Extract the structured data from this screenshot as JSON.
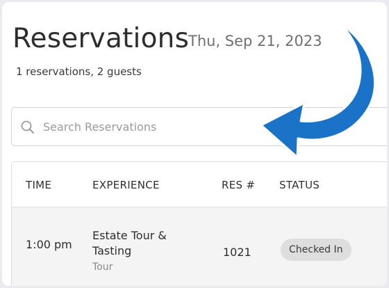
{
  "header": {
    "title": "Reservations",
    "date": "Thu, Sep 21, 2023",
    "summary": "1 reservations, 2 guests"
  },
  "search": {
    "placeholder": "Search Reservations",
    "icon": "search-icon"
  },
  "table": {
    "columns": [
      "TIME",
      "EXPERIENCE",
      "RES #",
      "STATUS"
    ],
    "rows": [
      {
        "time": "1:00 pm",
        "experience": "Estate Tour & Tasting",
        "experience_type": "Tour",
        "res_number": "1021",
        "status": "Checked In"
      }
    ]
  },
  "annotation": {
    "icon": "curved-arrow-icon",
    "color": "#1a73c7"
  }
}
